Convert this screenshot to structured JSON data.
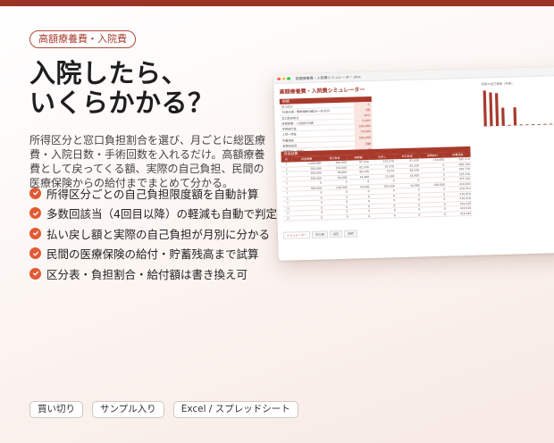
{
  "tag": "高額療養費・入院費",
  "headline": [
    "入院したら、",
    "いくらかかる？"
  ],
  "description": "所得区分と窓口負担割合を選び、月ごとに総医療費・入院日数・手術回数を入れるだけ。高額療養費として戻ってくる額、実際の自己負担、民間の医療保険からの給付までまとめて分かる。",
  "features": [
    "所得区分ごとの自己負担限度額を自動計算",
    "多数回該当（4回目以降）の軽減も自動で判定",
    "払い戻し額と実際の自己負担が月別に分かる",
    "民間の医療保険の給付・貯蓄残高まで試算",
    "区分表・負担割合・給付額は書き換え可"
  ],
  "badges": [
    "買い切り",
    "サンプル入り",
    "Excel / スプレッドシート"
  ],
  "mockup": {
    "window_title": "高額療養費・入院費シミュレーター.xlsx",
    "app_title": "高額療養費・入院費シミュレーター",
    "input_header": "前提",
    "input_rows": [
      {
        "k": "加入区分",
        "v": "ウ"
      },
      {
        "k": "70歳未満・標準報酬月額28〜50万円",
        "v": "3割"
      },
      {
        "k": "窓口負担割合",
        "v": "30%"
      },
      {
        "k": "民間保険・入院給付日額",
        "v": "5,000"
      },
      {
        "k": "手術給付金",
        "v": "100,000"
      },
      {
        "k": "入院一時金",
        "v": "50,000"
      },
      {
        "k": "貯蓄残高",
        "v": "500,000"
      },
      {
        "k": "多数回該当",
        "v": "自動"
      },
      {
        "k": "所得区分（参考）",
        "v": "ウ"
      },
      {
        "k": "世帯合算",
        "v": "なし"
      }
    ],
    "chart_caption": "月別の自己負担（月末）",
    "result_header": "月別試算",
    "result_columns": [
      "月",
      "総医療費",
      "窓口負担",
      "限度額",
      "払戻し",
      "自己負担",
      "保険給付",
      "貯蓄残高"
    ],
    "result_rows": [
      [
        "1",
        "1,000,000",
        "300,000",
        "87,430",
        "212,570",
        "87,430",
        "150,000",
        "562,570"
      ],
      [
        "2",
        "500,000",
        "150,000",
        "82,430",
        "67,570",
        "82,430",
        "0",
        "480,140"
      ],
      [
        "3",
        "300,000",
        "90,000",
        "80,430",
        "9,570",
        "80,430",
        "0",
        "399,710"
      ],
      [
        "4",
        "200,000",
        "60,000",
        "44,400",
        "15,600",
        "44,400",
        "0",
        "355,310"
      ],
      [
        "5",
        "0",
        "0",
        "0",
        "0",
        "0",
        "0",
        "355,310"
      ],
      [
        "6",
        "800,000",
        "240,000",
        "44,400",
        "195,600",
        "44,400",
        "100,000",
        "410,910"
      ],
      [
        "7",
        "0",
        "0",
        "0",
        "0",
        "0",
        "0",
        "410,910"
      ],
      [
        "8",
        "0",
        "0",
        "0",
        "0",
        "0",
        "0",
        "410,910"
      ],
      [
        "9",
        "0",
        "0",
        "0",
        "0",
        "0",
        "0",
        "410,910"
      ],
      [
        "10",
        "0",
        "0",
        "0",
        "0",
        "0",
        "0",
        "410,910"
      ],
      [
        "11",
        "0",
        "0",
        "0",
        "0",
        "0",
        "0",
        "410,910"
      ],
      [
        "12",
        "0",
        "0",
        "0",
        "0",
        "0",
        "0",
        "410,910"
      ]
    ],
    "sheet_tabs": [
      "シミュレーター",
      "区分表",
      "設定",
      "説明"
    ],
    "chart_bars": [
      87430,
      82430,
      80430,
      44400,
      0,
      44400,
      0,
      0,
      0,
      0,
      0,
      0
    ],
    "accent": "#a83a2c"
  }
}
